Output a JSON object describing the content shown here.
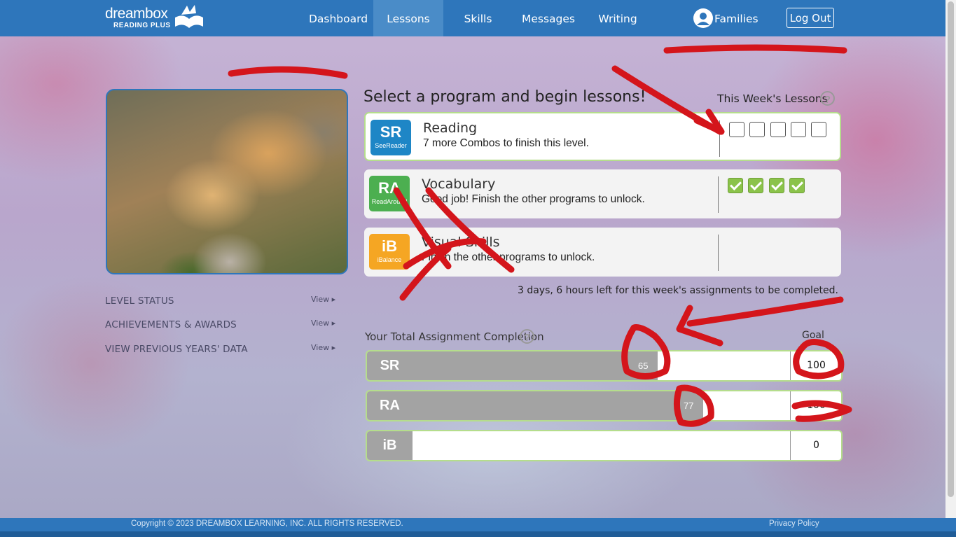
{
  "brand": {
    "name": "dreambox",
    "sub": "READING PLUS"
  },
  "nav": {
    "items": [
      "Dashboard",
      "Lessons",
      "Skills",
      "Messages",
      "Writing"
    ],
    "active": "Lessons",
    "families": "Families",
    "logout": "Log Out"
  },
  "sidebar": {
    "links": [
      {
        "label": "LEVEL STATUS",
        "action": "View"
      },
      {
        "label": "ACHIEVEMENTS & AWARDS",
        "action": "View"
      },
      {
        "label": "VIEW PREVIOUS YEARS' DATA",
        "action": "View"
      }
    ]
  },
  "programs": {
    "headline": "Select a program and begin lessons!",
    "week_label": "This Week's Lessons",
    "help_icon": "?",
    "items": [
      {
        "badge": "SR",
        "badge_sub": "SeeReader",
        "badge_color": "#1e86c6",
        "title": "Reading",
        "subtitle": "7 more Combos to finish this level.",
        "lessons": [
          false,
          false,
          false,
          false,
          false
        ]
      },
      {
        "badge": "RA",
        "badge_sub": "ReadAround",
        "badge_color": "#4caf50",
        "title": "Vocabulary",
        "subtitle": "Good job! Finish the other programs to unlock.",
        "lessons": [
          true,
          true,
          true,
          true
        ]
      },
      {
        "badge": "iB",
        "badge_sub": "iBalance",
        "badge_color": "#f5a623",
        "title": "Visual Skills",
        "subtitle": "Finish the other programs to unlock.",
        "lessons": []
      }
    ],
    "time_left": "3 days, 6 hours left for this week's assignments to be completed."
  },
  "completion": {
    "label": "Your Total Assignment Completion",
    "goal_label": "Goal",
    "rows": [
      {
        "icon": "SR",
        "value": 65,
        "goal": "100"
      },
      {
        "icon": "RA",
        "value": 77,
        "goal": "100"
      },
      {
        "icon": "iB",
        "value": 0,
        "goal": "0"
      }
    ]
  },
  "footer": {
    "copyright": "Copyright © 2023 DREAMBOX LEARNING, INC. ALL RIGHTS RESERVED.",
    "privacy": "Privacy Policy"
  }
}
